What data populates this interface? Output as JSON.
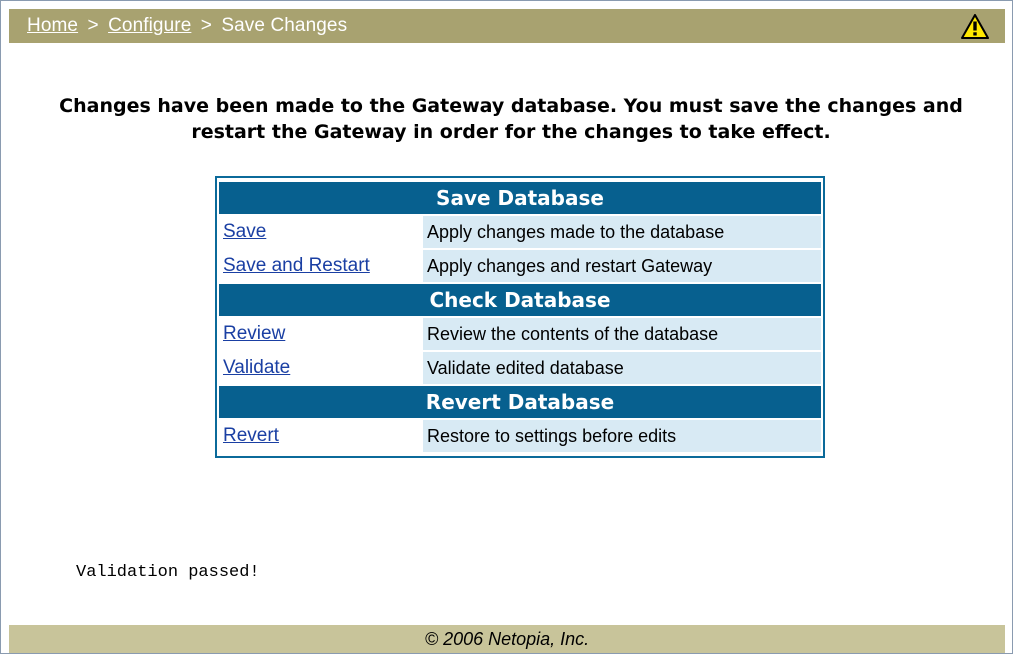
{
  "breadcrumb": {
    "home": "Home",
    "separator": ">",
    "configure": "Configure",
    "current": "Save Changes"
  },
  "warning_icon": "warning-triangle-icon",
  "message": "Changes have been made to the Gateway database. You must save the changes and restart the Gateway in order for the changes to take effect.",
  "sections": [
    {
      "title": "Save Database",
      "rows": [
        {
          "link": "Save",
          "description": "Apply changes made to the database"
        },
        {
          "link": "Save and Restart",
          "description": "Apply changes and restart Gateway"
        }
      ]
    },
    {
      "title": "Check Database",
      "rows": [
        {
          "link": "Review",
          "description": "Review the contents of the database"
        },
        {
          "link": "Validate",
          "description": "Validate edited database"
        }
      ]
    },
    {
      "title": "Revert Database",
      "rows": [
        {
          "link": "Revert",
          "description": "Restore to settings before edits"
        }
      ]
    }
  ],
  "status": "Validation passed!",
  "footer": "© 2006 Netopia, Inc.",
  "colors": {
    "topbar": "#a8a270",
    "footer": "#c8c49a",
    "header_blue": "#07608f",
    "row_light_blue": "#d8eaf4",
    "link_blue": "#1a3fa3"
  }
}
